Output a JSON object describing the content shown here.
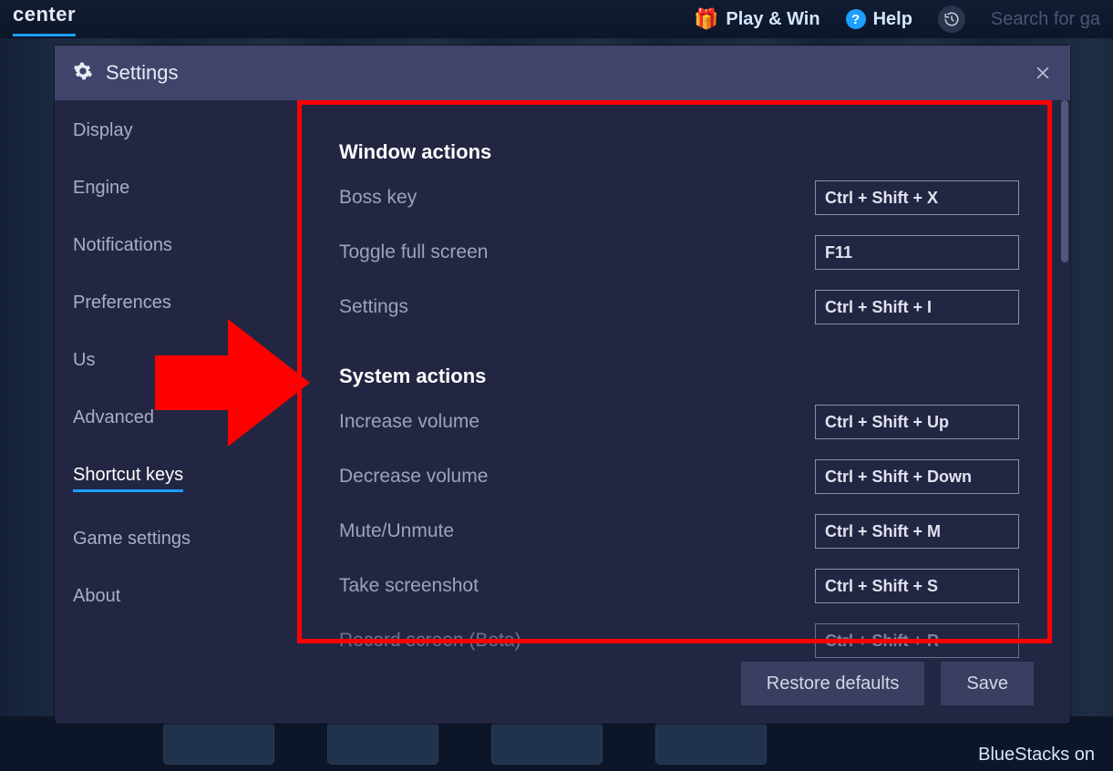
{
  "bg": {
    "brand": "center",
    "play_win": "Play & Win",
    "help": "Help",
    "search_placeholder": "Search for ga",
    "footer_text": "BlueStacks on"
  },
  "modal": {
    "title": "Settings"
  },
  "sidebar": {
    "items": [
      {
        "label": "Display"
      },
      {
        "label": "Engine"
      },
      {
        "label": "Notifications"
      },
      {
        "label": "Preferences"
      },
      {
        "label": "Us"
      },
      {
        "label": "Advanced"
      },
      {
        "label": "Shortcut keys"
      },
      {
        "label": "Game settings"
      },
      {
        "label": "About"
      }
    ]
  },
  "sections": {
    "window": {
      "title": "Window actions",
      "rows": [
        {
          "label": "Boss key",
          "value": "Ctrl + Shift + X"
        },
        {
          "label": "Toggle full screen",
          "value": "F11"
        },
        {
          "label": "Settings",
          "value": "Ctrl + Shift + I"
        }
      ]
    },
    "system": {
      "title": "System actions",
      "rows": [
        {
          "label": "Increase volume",
          "value": "Ctrl + Shift + Up"
        },
        {
          "label": "Decrease volume",
          "value": "Ctrl + Shift + Down"
        },
        {
          "label": "Mute/Unmute",
          "value": "Ctrl + Shift + M"
        },
        {
          "label": "Take screenshot",
          "value": "Ctrl + Shift + S"
        },
        {
          "label": "Record screen (Beta)",
          "value": "Ctrl + Shift + R",
          "dim": true
        }
      ]
    }
  },
  "footer": {
    "restore": "Restore defaults",
    "save": "Save"
  }
}
